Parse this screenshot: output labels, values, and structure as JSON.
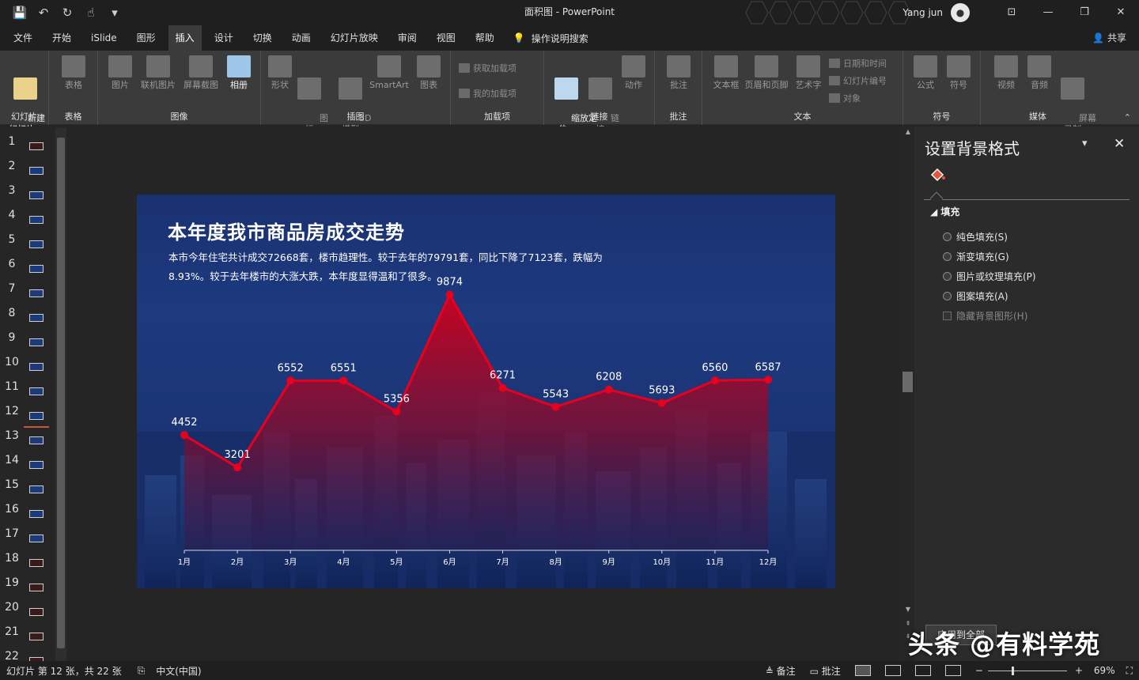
{
  "titlebar": {
    "title": "面积图  -  PowerPoint",
    "user": "Yang jun",
    "qat_icons": [
      "save-icon",
      "undo-icon",
      "redo-icon",
      "touch-mode-icon"
    ]
  },
  "tabs": [
    "文件",
    "开始",
    "iSlide",
    "图形",
    "插入",
    "设计",
    "切换",
    "动画",
    "幻灯片放映",
    "审阅",
    "视图",
    "帮助"
  ],
  "active_tab": "插入",
  "search_label": "操作说明搜索",
  "share_label": "共享",
  "ribbon": {
    "groups": {
      "slides": "幻灯片",
      "table": "表格",
      "images": "图像",
      "illustrations": "插图",
      "addins": "加载项",
      "links": "链接",
      "comments": "批注",
      "text": "文本",
      "symbols": "符号",
      "media": "媒体"
    },
    "buttons": {
      "new_slide": "新建\n幻灯片 ▾",
      "table": "表格",
      "picture": "图片",
      "online_picture": "联机图片",
      "screenshot": "屏幕截图",
      "album": "相册",
      "shapes": "形状",
      "icons": "图\n标",
      "model3d": "3D\n模型",
      "smartart": "SmartArt",
      "chart": "图表",
      "get_addins": "获取加载项",
      "my_addins": "我的加载项",
      "zoom": "缩放定\n位 ▾",
      "link": "链\n接",
      "action": "动作",
      "comment": "批注",
      "textbox": "文本框",
      "header_footer": "页眉和页脚",
      "wordart": "艺术字",
      "date_time": "日期和时间",
      "slide_number": "幻灯片编号",
      "object": "对象",
      "equation": "公式",
      "symbol": "符号",
      "video": "视频",
      "audio": "音频",
      "screen_record": "屏幕\n录制"
    }
  },
  "thumbnails": [
    "1",
    "2",
    "3",
    "4",
    "5",
    "6",
    "7",
    "8",
    "9",
    "10",
    "11",
    "12",
    "13",
    "14",
    "15",
    "16",
    "17",
    "18",
    "19",
    "20",
    "21",
    "22"
  ],
  "selected_slide": "12",
  "slide": {
    "title": "本年度我市商品房成交走势",
    "description": "本市今年住宅共计成交72668套，楼市趋理性。较于去年的79791套，同比下降了7123套，跌幅为8.93%。较于去年楼市的大涨大跌，本年度显得温和了很多。"
  },
  "chart_data": {
    "type": "area",
    "categories": [
      "1月",
      "2月",
      "3月",
      "4月",
      "5月",
      "6月",
      "7月",
      "8月",
      "9月",
      "10月",
      "11月",
      "12月"
    ],
    "series": [
      {
        "values": [
          4452,
          3201,
          6552,
          6551,
          5356,
          9874,
          6271,
          5543,
          6208,
          5693,
          6560,
          6587
        ]
      }
    ],
    "ylim": [
      0,
      12000
    ],
    "grid": false,
    "legend": "none",
    "line_color": "#e8001e",
    "fill_color": "#c8001a"
  },
  "pane": {
    "title": "设置背景格式",
    "section": "填充",
    "options": [
      "纯色填充(S)",
      "渐变填充(G)",
      "图片或纹理填充(P)",
      "图案填充(A)"
    ],
    "checkbox": "隐藏背景图形(H)",
    "apply_btn": "应用到全部"
  },
  "watermark": "头条 @有料学苑",
  "status": {
    "slide_info": "幻灯片 第 12 张，共 22 张",
    "language": "中文(中国)",
    "notes": "备注",
    "comments": "批注",
    "zoom": "69%"
  }
}
